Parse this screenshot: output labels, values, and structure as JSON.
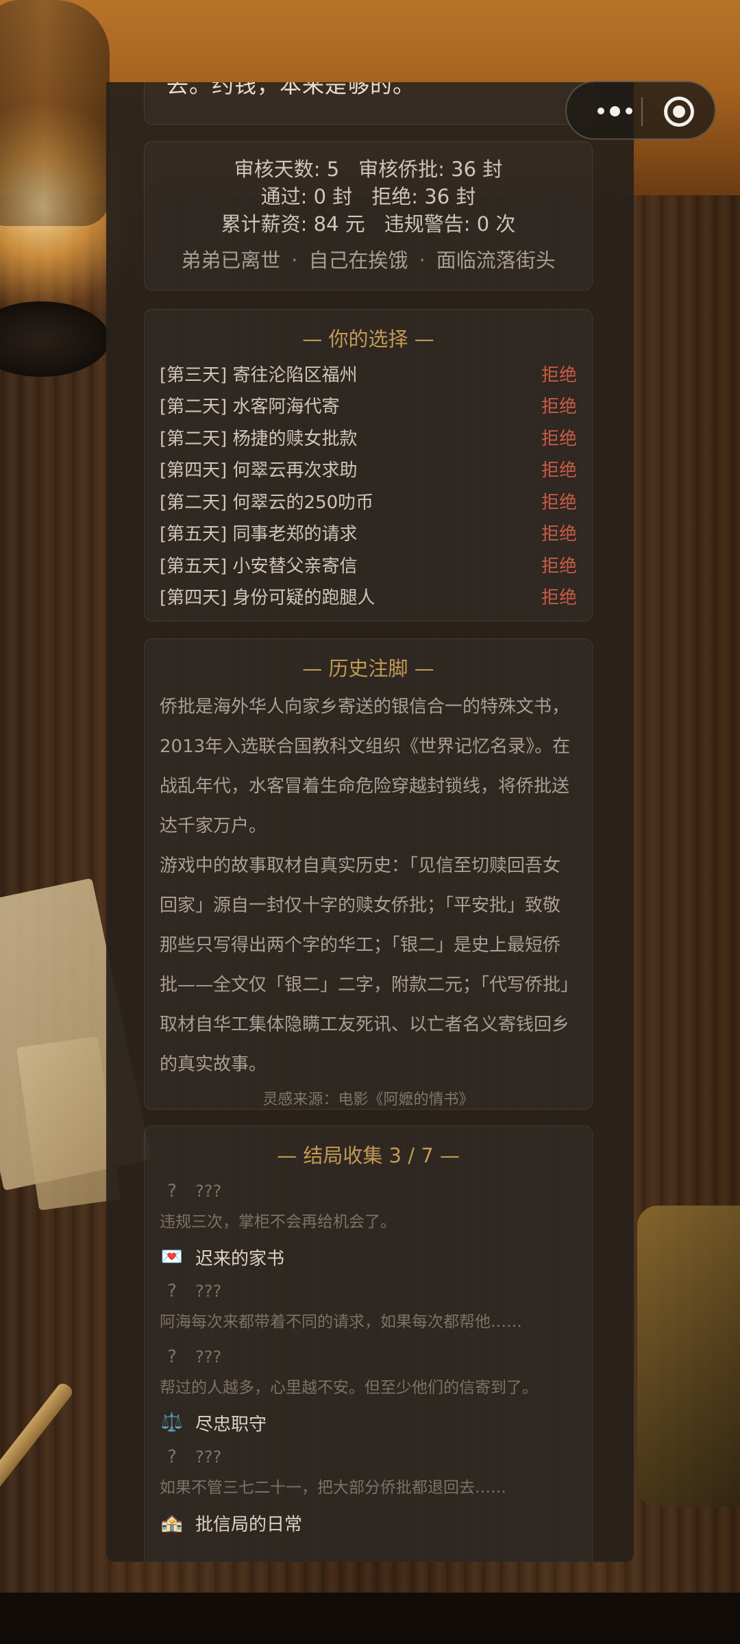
{
  "top_snippet": "去。约钱，本来是够的。",
  "stats": {
    "days": "审核天数: 5",
    "reviewed": "审核侨批: 36 封",
    "passed": "通过: 0 封",
    "rejected": "拒绝: 36 封",
    "wage": "累计薪资: 84 元",
    "warnings": "违规警告: 0 次",
    "status": [
      "弟弟已离世",
      "自己在挨饿",
      "面临流落街头"
    ]
  },
  "choices": {
    "title": "— 你的选择 —",
    "items": [
      {
        "label": "[第三天] 寄往沦陷区福州",
        "result": "拒绝"
      },
      {
        "label": "[第二天] 水客阿海代寄",
        "result": "拒绝"
      },
      {
        "label": "[第二天] 杨捷的赎女批款",
        "result": "拒绝"
      },
      {
        "label": "[第四天] 何翠云再次求助",
        "result": "拒绝"
      },
      {
        "label": "[第二天] 何翠云的250叻币",
        "result": "拒绝"
      },
      {
        "label": "[第五天] 同事老郑的请求",
        "result": "拒绝"
      },
      {
        "label": "[第五天] 小安替父亲寄信",
        "result": "拒绝"
      },
      {
        "label": "[第四天] 身份可疑的跑腿人",
        "result": "拒绝"
      }
    ]
  },
  "history": {
    "title": "— 历史注脚 —",
    "paragraph1": "侨批是海外华人向家乡寄送的银信合一的特殊文书，2013年入选联合国教科文组织《世界记忆名录》。在战乱年代，水客冒着生命危险穿越封锁线，将侨批送达千家万户。",
    "paragraph2": "游戏中的故事取材自真实历史：「见信至切赎回吾女回家」源自一封仅十字的赎女侨批；「平安批」致敬那些只写得出两个字的华工；「银二」是史上最短侨批——全文仅「银二」二字，附款二元；「代写侨批」取材自华工集体隐瞒工友死讯、以亡者名义寄钱回乡的真实故事。",
    "source": "灵感来源：电影《阿嬷的情书》"
  },
  "endings": {
    "title": "— 结局收集 3 / 7 —",
    "items": [
      {
        "icon": "?",
        "name": "???",
        "hint": "违规三次，掌柜不会再给机会了。"
      },
      {
        "icon": "💌",
        "name": "迟来的家书"
      },
      {
        "icon": "?",
        "name": "???",
        "hint": "阿海每次来都带着不同的请求，如果每次都帮他……"
      },
      {
        "icon": "?",
        "name": "???",
        "hint": "帮过的人越多，心里越不安。但至少他们的信寄到了。"
      },
      {
        "icon": "⚖️",
        "name": "尽忠职守"
      },
      {
        "icon": "?",
        "name": "???",
        "hint": "如果不管三七二十一，把大部分侨批都退回去……"
      },
      {
        "icon": "🏤",
        "name": "批信局的日常"
      }
    ]
  }
}
